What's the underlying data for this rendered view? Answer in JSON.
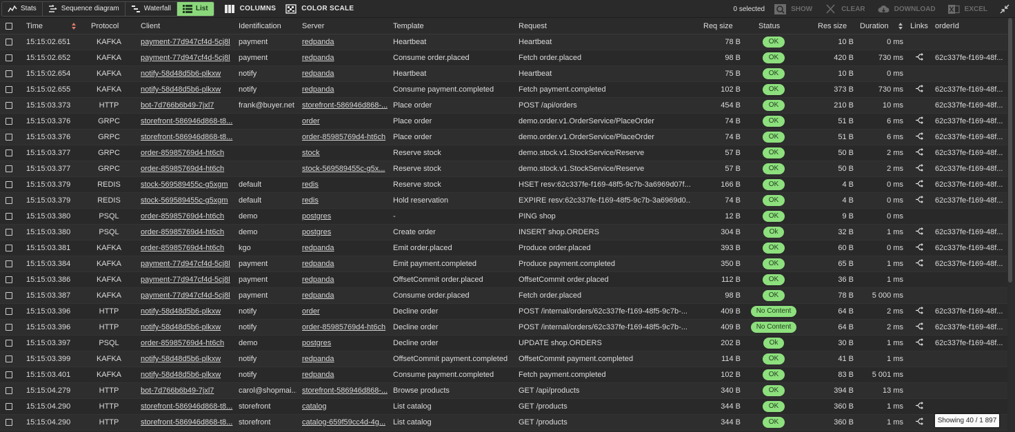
{
  "toolbar": {
    "views": [
      {
        "label": "Stats",
        "icon": "stats-icon",
        "active": false
      },
      {
        "label": "Sequence diagram",
        "icon": "sequence-icon",
        "active": false
      },
      {
        "label": "Waterfall",
        "icon": "waterfall-icon",
        "active": false
      },
      {
        "label": "List",
        "icon": "list-icon",
        "active": true
      }
    ],
    "columns_label": "COLUMNS",
    "color_scale_label": "COLOR SCALE",
    "selected_count": "0 selected",
    "show_label": "SHOW",
    "clear_label": "CLEAR",
    "download_label": "DOWNLOAD",
    "excel_label": "EXCEL"
  },
  "columns": [
    "Time",
    "Protocol",
    "Client",
    "Identification",
    "Server",
    "Template",
    "Request",
    "Req size",
    "Status",
    "Res size",
    "Duration",
    "Links",
    "orderId"
  ],
  "rows": [
    {
      "time": "15:15:02.651",
      "proto": "KAFKA",
      "client": "payment-77d947cf4d-5cj8l",
      "ident": "payment",
      "server": "redpanda",
      "tmpl": "Heartbeat",
      "req": "Heartbeat",
      "reqsize": "78 B",
      "status": "OK",
      "ressize": "10 B",
      "dur": "0 ms",
      "link": false,
      "oid": ""
    },
    {
      "time": "15:15:02.652",
      "proto": "KAFKA",
      "client": "payment-77d947cf4d-5cj8l",
      "ident": "payment",
      "server": "redpanda",
      "tmpl": "Consume order.placed",
      "req": "Fetch order.placed",
      "reqsize": "98 B",
      "status": "OK",
      "ressize": "420 B",
      "dur": "730 ms",
      "link": true,
      "oid": "62c337fe-f169-48f..."
    },
    {
      "time": "15:15:02.654",
      "proto": "KAFKA",
      "client": "notify-58d48d5b6-plkxw",
      "ident": "notify",
      "server": "redpanda",
      "tmpl": "Heartbeat",
      "req": "Heartbeat",
      "reqsize": "75 B",
      "status": "OK",
      "ressize": "10 B",
      "dur": "0 ms",
      "link": false,
      "oid": ""
    },
    {
      "time": "15:15:02.655",
      "proto": "KAFKA",
      "client": "notify-58d48d5b6-plkxw",
      "ident": "notify",
      "server": "redpanda",
      "tmpl": "Consume payment.completed",
      "req": "Fetch payment.completed",
      "reqsize": "102 B",
      "status": "OK",
      "ressize": "373 B",
      "dur": "730 ms",
      "link": true,
      "oid": "62c337fe-f169-48f..."
    },
    {
      "time": "15:15:03.373",
      "proto": "HTTP",
      "client": "bot-7d766b6b49-7jxl7",
      "ident": "frank@buyer.net",
      "server": "storefront-586946d868-...",
      "tmpl": "Place order",
      "req": "POST /api/orders",
      "reqsize": "454 B",
      "status": "OK",
      "ressize": "210 B",
      "dur": "10 ms",
      "link": false,
      "oid": "62c337fe-f169-48f..."
    },
    {
      "time": "15:15:03.376",
      "proto": "GRPC",
      "client": "storefront-586946d868-t8...",
      "ident": "",
      "server": "order",
      "tmpl": "Place order",
      "req": "demo.order.v1.OrderService/PlaceOrder",
      "reqsize": "74 B",
      "status": "OK",
      "ressize": "51 B",
      "dur": "6 ms",
      "link": true,
      "oid": "62c337fe-f169-48f..."
    },
    {
      "time": "15:15:03.376",
      "proto": "GRPC",
      "client": "storefront-586946d868-t8...",
      "ident": "",
      "server": "order-85985769d4-ht6ch",
      "tmpl": "Place order",
      "req": "demo.order.v1.OrderService/PlaceOrder",
      "reqsize": "74 B",
      "status": "OK",
      "ressize": "51 B",
      "dur": "6 ms",
      "link": true,
      "oid": "62c337fe-f169-48f..."
    },
    {
      "time": "15:15:03.377",
      "proto": "GRPC",
      "client": "order-85985769d4-ht6ch",
      "ident": "",
      "server": "stock",
      "tmpl": "Reserve stock",
      "req": "demo.stock.v1.StockService/Reserve",
      "reqsize": "57 B",
      "status": "OK",
      "ressize": "50 B",
      "dur": "2 ms",
      "link": true,
      "oid": "62c337fe-f169-48f..."
    },
    {
      "time": "15:15:03.377",
      "proto": "GRPC",
      "client": "order-85985769d4-ht6ch",
      "ident": "",
      "server": "stock-569589455c-g5x...",
      "tmpl": "Reserve stock",
      "req": "demo.stock.v1.StockService/Reserve",
      "reqsize": "57 B",
      "status": "OK",
      "ressize": "50 B",
      "dur": "2 ms",
      "link": true,
      "oid": "62c337fe-f169-48f..."
    },
    {
      "time": "15:15:03.379",
      "proto": "REDIS",
      "client": "stock-569589455c-g5xgm",
      "ident": "default",
      "server": "redis",
      "tmpl": "Reserve stock",
      "req": "HSET resv:62c337fe-f169-48f5-9c7b-3a6969d07f...",
      "reqsize": "166 B",
      "status": "OK",
      "ressize": "4 B",
      "dur": "0 ms",
      "link": true,
      "oid": "62c337fe-f169-48f..."
    },
    {
      "time": "15:15:03.379",
      "proto": "REDIS",
      "client": "stock-569589455c-g5xgm",
      "ident": "default",
      "server": "redis",
      "tmpl": "Hold reservation",
      "req": "EXPIRE resv:62c337fe-f169-48f5-9c7b-3a6969d0...",
      "reqsize": "74 B",
      "status": "OK",
      "ressize": "4 B",
      "dur": "0 ms",
      "link": true,
      "oid": "62c337fe-f169-48f..."
    },
    {
      "time": "15:15:03.380",
      "proto": "PSQL",
      "client": "order-85985769d4-ht6ch",
      "ident": "demo",
      "server": "postgres",
      "tmpl": "-",
      "req": "PING shop",
      "reqsize": "12 B",
      "status": "OK",
      "ressize": "9 B",
      "dur": "0 ms",
      "link": false,
      "oid": ""
    },
    {
      "time": "15:15:03.380",
      "proto": "PSQL",
      "client": "order-85985769d4-ht6ch",
      "ident": "demo",
      "server": "postgres",
      "tmpl": "Create order",
      "req": "INSERT shop.ORDERS",
      "reqsize": "304 B",
      "status": "Ok",
      "ressize": "32 B",
      "dur": "1 ms",
      "link": true,
      "oid": "62c337fe-f169-48f..."
    },
    {
      "time": "15:15:03.381",
      "proto": "KAFKA",
      "client": "order-85985769d4-ht6ch",
      "ident": "kgo",
      "server": "redpanda",
      "tmpl": "Emit order.placed",
      "req": "Produce order.placed",
      "reqsize": "393 B",
      "status": "OK",
      "ressize": "60 B",
      "dur": "0 ms",
      "link": true,
      "oid": "62c337fe-f169-48f..."
    },
    {
      "time": "15:15:03.384",
      "proto": "KAFKA",
      "client": "payment-77d947cf4d-5cj8l",
      "ident": "payment",
      "server": "redpanda",
      "tmpl": "Emit payment.completed",
      "req": "Produce payment.completed",
      "reqsize": "350 B",
      "status": "OK",
      "ressize": "65 B",
      "dur": "1 ms",
      "link": true,
      "oid": "62c337fe-f169-48f..."
    },
    {
      "time": "15:15:03.386",
      "proto": "KAFKA",
      "client": "payment-77d947cf4d-5cj8l",
      "ident": "payment",
      "server": "redpanda",
      "tmpl": "OffsetCommit order.placed",
      "req": "OffsetCommit order.placed",
      "reqsize": "112 B",
      "status": "OK",
      "ressize": "36 B",
      "dur": "1 ms",
      "link": false,
      "oid": ""
    },
    {
      "time": "15:15:03.387",
      "proto": "KAFKA",
      "client": "payment-77d947cf4d-5cj8l",
      "ident": "payment",
      "server": "redpanda",
      "tmpl": "Consume order.placed",
      "req": "Fetch order.placed",
      "reqsize": "98 B",
      "status": "OK",
      "ressize": "78 B",
      "dur": "5 000 ms",
      "link": false,
      "oid": ""
    },
    {
      "time": "15:15:03.396",
      "proto": "HTTP",
      "client": "notify-58d48d5b6-plkxw",
      "ident": "notify",
      "server": "order",
      "tmpl": "Decline order",
      "req": "POST /internal/orders/62c337fe-f169-48f5-9c7b-...",
      "reqsize": "409 B",
      "status": "No Content",
      "ressize": "64 B",
      "dur": "2 ms",
      "link": true,
      "oid": "62c337fe-f169-48f..."
    },
    {
      "time": "15:15:03.396",
      "proto": "HTTP",
      "client": "notify-58d48d5b6-plkxw",
      "ident": "notify",
      "server": "order-85985769d4-ht6ch",
      "tmpl": "Decline order",
      "req": "POST /internal/orders/62c337fe-f169-48f5-9c7b-...",
      "reqsize": "409 B",
      "status": "No Content",
      "ressize": "64 B",
      "dur": "2 ms",
      "link": true,
      "oid": "62c337fe-f169-48f..."
    },
    {
      "time": "15:15:03.397",
      "proto": "PSQL",
      "client": "order-85985769d4-ht6ch",
      "ident": "demo",
      "server": "postgres",
      "tmpl": "Decline order",
      "req": "UPDATE shop.ORDERS",
      "reqsize": "202 B",
      "status": "Ok",
      "ressize": "30 B",
      "dur": "1 ms",
      "link": true,
      "oid": "62c337fe-f169-48f..."
    },
    {
      "time": "15:15:03.399",
      "proto": "KAFKA",
      "client": "notify-58d48d5b6-plkxw",
      "ident": "notify",
      "server": "redpanda",
      "tmpl": "OffsetCommit payment.completed",
      "req": "OffsetCommit payment.completed",
      "reqsize": "114 B",
      "status": "OK",
      "ressize": "41 B",
      "dur": "1 ms",
      "link": false,
      "oid": ""
    },
    {
      "time": "15:15:03.401",
      "proto": "KAFKA",
      "client": "notify-58d48d5b6-plkxw",
      "ident": "notify",
      "server": "redpanda",
      "tmpl": "Consume payment.completed",
      "req": "Fetch payment.completed",
      "reqsize": "102 B",
      "status": "OK",
      "ressize": "83 B",
      "dur": "5 001 ms",
      "link": false,
      "oid": ""
    },
    {
      "time": "15:15:04.279",
      "proto": "HTTP",
      "client": "bot-7d766b6b49-7jxl7",
      "ident": "carol@shopmai...",
      "server": "storefront-586946d868-...",
      "tmpl": "Browse products",
      "req": "GET /api/products",
      "reqsize": "340 B",
      "status": "OK",
      "ressize": "394 B",
      "dur": "13 ms",
      "link": false,
      "oid": ""
    },
    {
      "time": "15:15:04.290",
      "proto": "HTTP",
      "client": "storefront-586946d868-t8...",
      "ident": "storefront",
      "server": "catalog",
      "tmpl": "List catalog",
      "req": "GET /products",
      "reqsize": "344 B",
      "status": "OK",
      "ressize": "360 B",
      "dur": "1 ms",
      "link": true,
      "oid": ""
    },
    {
      "time": "15:15:04.290",
      "proto": "HTTP",
      "client": "storefront-586946d868-t8...",
      "ident": "storefront",
      "server": "catalog-659f59cc4d-4g...",
      "tmpl": "List catalog",
      "req": "GET /products",
      "reqsize": "344 B",
      "status": "OK",
      "ressize": "360 B",
      "dur": "1 ms",
      "link": true,
      "oid": ""
    }
  ],
  "footer": {
    "showing": "Showing 40 / 1 897"
  },
  "colors": {
    "accent": "#8bd77b",
    "status_ok": "#8de07d",
    "background": "#2b2b2b"
  }
}
